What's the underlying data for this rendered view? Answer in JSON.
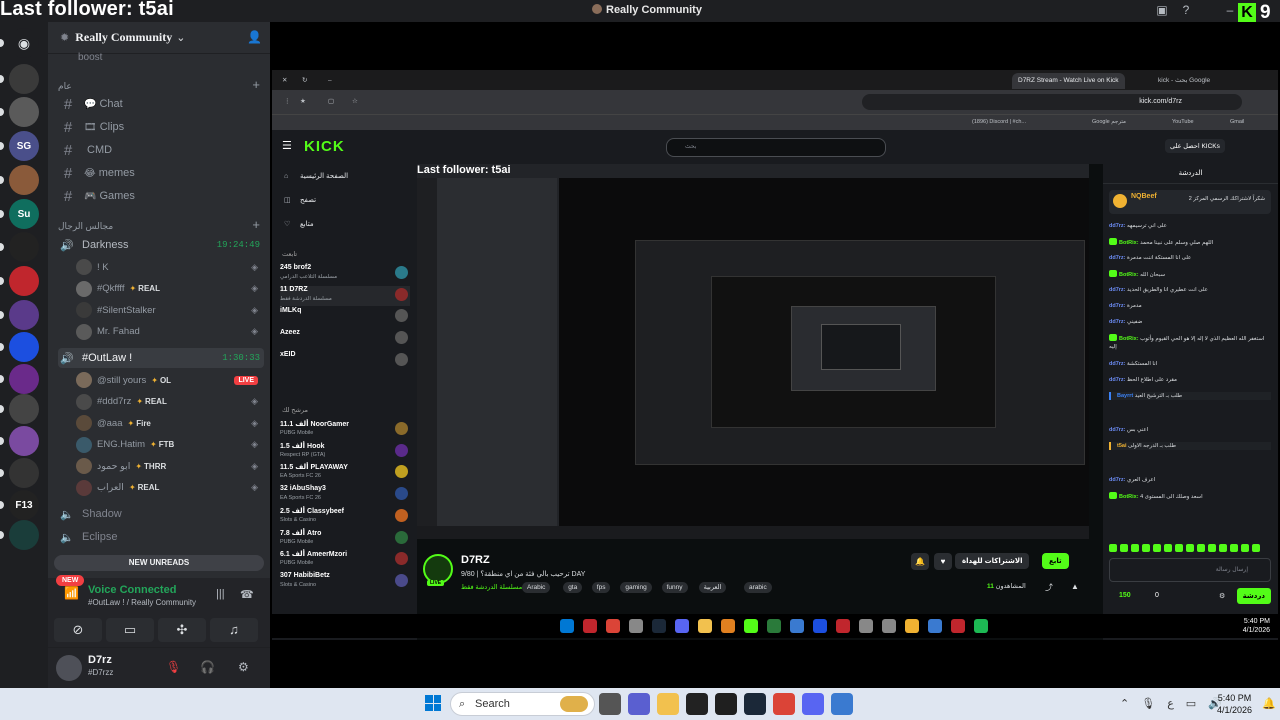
{
  "overlay": {
    "last_follower": "Last follower: t5ai"
  },
  "titlebar": {
    "server_name": "Really Community"
  },
  "kick_overlay": {
    "count": "9"
  },
  "server_rail": {
    "items": [
      {
        "icon": "discord-logo-icon",
        "color": "#1e1f22",
        "label": ""
      },
      {
        "icon": "server-icon",
        "color": "#3a3a3a",
        "label": ""
      },
      {
        "icon": "server-icon",
        "color": "#5a5a5a",
        "label": "",
        "badge": "1"
      },
      {
        "icon": "server-icon",
        "color": "#4a4f8a",
        "label": "SG",
        "badge": "2"
      },
      {
        "icon": "server-icon",
        "color": "#8a5a3a",
        "label": "",
        "badge": "1"
      },
      {
        "icon": "server-icon",
        "color": "#0f6e5e",
        "label": "Su"
      },
      {
        "icon": "server-icon",
        "color": "#222",
        "label": ""
      },
      {
        "icon": "server-icon",
        "color": "#c0262d",
        "label": ""
      },
      {
        "icon": "server-icon",
        "color": "#5a3a8a",
        "label": "",
        "badge": "1"
      },
      {
        "icon": "server-icon",
        "color": "#1c4fe0",
        "label": ""
      },
      {
        "icon": "server-icon",
        "color": "#6a2a8a",
        "label": "",
        "badge": "1"
      },
      {
        "icon": "server-icon",
        "color": "#444",
        "label": ""
      },
      {
        "icon": "server-icon",
        "color": "#7a4aa0",
        "label": ""
      },
      {
        "icon": "server-icon",
        "color": "#333",
        "label": ""
      },
      {
        "icon": "server-icon",
        "color": "#222",
        "label": "F13"
      },
      {
        "icon": "server-icon",
        "color": "#1a3d3a",
        "label": ""
      }
    ]
  },
  "sidebar": {
    "server_name": "Really Community",
    "boost": "boost",
    "category_text": "عام",
    "category_voice": "مجالس الرجال",
    "text_channels": [
      {
        "emoji": "💬",
        "name": "Chat"
      },
      {
        "emoji": "🎞",
        "name": "Clips"
      },
      {
        "emoji": "",
        "name": "CMD"
      },
      {
        "emoji": "😂",
        "name": "memes"
      },
      {
        "emoji": "🎮",
        "name": "Games"
      }
    ],
    "voice_darkness": {
      "name": "Darkness",
      "timer": "19:24:49"
    },
    "darkness_users": [
      {
        "name": "! K",
        "tag": "",
        "avatar": "#4a4a4a"
      },
      {
        "name": "#Qkffff",
        "tag": "REAL",
        "avatar": "#6a6a6a"
      },
      {
        "name": "#SilentStalker",
        "tag": "",
        "avatar": "#3a3a3a"
      },
      {
        "name": "Mr. Fahad",
        "tag": "",
        "avatar": "#5a5a5a"
      }
    ],
    "voice_outlaw": {
      "name": "#OutLaw !",
      "timer": "1:30:33"
    },
    "outlaw_users": [
      {
        "name": "@still yours",
        "tag": "OL",
        "avatar": "#7a6a5a",
        "live": "LIVE"
      },
      {
        "name": "#ddd7rz",
        "tag": "REAL",
        "avatar": "#4a4a4a"
      },
      {
        "name": "@aaa",
        "tag": "Fire",
        "avatar": "#5a4a3a"
      },
      {
        "name": "ENG.Hatim",
        "tag": "FTB",
        "avatar": "#3a5a6a"
      },
      {
        "name": "ابو حمود",
        "tag": "THRR",
        "avatar": "#6a5a4a"
      },
      {
        "name": "العراب",
        "tag": "REAL",
        "avatar": "#5a3a3a"
      }
    ],
    "other_voice": [
      "Shadow",
      "Eclipse"
    ],
    "new_unreads": "NEW UNREADS",
    "new_tag": "NEW",
    "voice_connected": "Voice Connected",
    "voice_location": "#OutLaw ! / Really Community",
    "user_name": "D7rz",
    "user_status": "#D7rzz"
  },
  "browser": {
    "tabs": [
      {
        "label": "D7RZ Stream - Watch Live on Kick",
        "active": true
      },
      {
        "label": "kick - بحث Google",
        "active": false
      }
    ],
    "url": "kick.com/d7rz",
    "bookmarks": [
      "(1896) Discord | #ch...",
      "Google مترجم",
      "YouTube",
      "Gmail"
    ]
  },
  "kick": {
    "logo": "KICK",
    "search_placeholder": "بحث",
    "get_kicks": "احصل على KICKs",
    "nav": [
      "الصفحة الرئيسية",
      "تصفح",
      "متابع"
    ],
    "following_head": "تابعت",
    "recommended_head": "مرشح لك",
    "following": [
      {
        "name": "brof2",
        "sub": "مسلسلة التلاعب الدرامي",
        "viewers": "245",
        "color": "#2a7a8a"
      },
      {
        "name": "D7RZ",
        "sub": "مسلسلة الدردشة فقط",
        "viewers": "11",
        "color": "#8a2a2a"
      },
      {
        "name": "iMLKq",
        "sub": "",
        "viewers": "",
        "color": "#555"
      },
      {
        "name": "Azeez",
        "sub": "",
        "viewers": "",
        "color": "#555"
      },
      {
        "name": "xEID",
        "sub": "",
        "viewers": "",
        "color": "#555"
      }
    ],
    "recommended": [
      {
        "name": "NoorGamer",
        "sub": "PUBG Mobile",
        "viewers": "11.1 ألف",
        "color": "#8a6a2a"
      },
      {
        "name": "Hook",
        "sub": "Respect RP (GTA)",
        "viewers": "1.5 ألف",
        "color": "#5a2a8a"
      },
      {
        "name": "PLAYAWAY",
        "sub": "EA Sports FC 26",
        "viewers": "11.5 ألف",
        "color": "#c0a020"
      },
      {
        "name": "iAbuShay3",
        "sub": "EA Sports FC 26",
        "viewers": "32",
        "color": "#2a4a8a"
      },
      {
        "name": "Classybeef",
        "sub": "Slots & Casino",
        "viewers": "2.5 ألف",
        "color": "#c06020"
      },
      {
        "name": "Atro",
        "sub": "PUBG Mobile",
        "viewers": "7.8 ألف",
        "color": "#2a6a3a"
      },
      {
        "name": "AmeerMzori",
        "sub": "PUBG Mobile",
        "viewers": "6.1 ألف",
        "color": "#8a2a2a"
      },
      {
        "name": "HabibiBetz",
        "sub": "Slots & Casino",
        "viewers": "307",
        "color": "#4a4a8a"
      }
    ],
    "stream_overlay": "Last follower: t5ai",
    "streamer": "D7RZ",
    "stream_title": "ترحيب بالي فئة من اي منطقة؟ | 9/80 DAY",
    "stream_category": "مسلسلة الدردشة فقط",
    "live": "LIVE",
    "tags": [
      "Arabic",
      "gta",
      "fps",
      "gaming",
      "funny",
      "العربية",
      "arabic"
    ],
    "follow_btn": "تابع",
    "subscribe_btn": "الاشتراكات للهداة",
    "viewers_label": "المشاهدون",
    "viewers_count": "11",
    "chat_title": "الدردشة",
    "pinned_user": "NQBeef",
    "pinned_text": "شكراً لاشتراكك الرسمي المركز 2",
    "chat_messages": [
      {
        "user": "dd7rz:",
        "text": "على اني ترسيمهه",
        "type": ""
      },
      {
        "user": "BotRix:",
        "text": "اللهم صلي وسلم على نبينا محمد",
        "type": "bot"
      },
      {
        "user": "dd7rz:",
        "text": "على انا المستكة اننت مدمرة",
        "type": ""
      },
      {
        "user": "BotRix:",
        "text": "سبحان الله",
        "type": "bot"
      },
      {
        "user": "dd7rz:",
        "text": "على انت عطيري انا والطريق الحديد",
        "type": ""
      },
      {
        "user": "dd7rz:",
        "text": "مدمرة",
        "type": ""
      },
      {
        "user": "dd7rz:",
        "text": "ضفيني",
        "type": ""
      },
      {
        "user": "BotRix:",
        "text": "استغفر الله العظيم الذي لا إله إلا هو الحي القيوم وأتوب إليه",
        "type": "bot"
      },
      {
        "user": "dd7rz:",
        "text": "انا المستكشة",
        "type": ""
      },
      {
        "user": "dd7rz:",
        "text": "مقرد على اطلاع الحظ",
        "type": ""
      },
      {
        "user": "Bayrrt",
        "text": "طلب بـ الترشيح العيد",
        "type": "sub2"
      },
      {
        "user": "dd7rz:",
        "text": "اعني بس",
        "type": ""
      },
      {
        "user": "t5ai",
        "text": "طلب بـ الدرجه الاولى",
        "type": "sub"
      },
      {
        "user": "dd7rz:",
        "text": "اعرف العري",
        "type": ""
      },
      {
        "user": "BotRix:",
        "text": "اسعد وصلك الى المستوى 4",
        "type": "bot"
      }
    ],
    "chat_input": "إرسال رسالة",
    "points": "150",
    "points2": "0",
    "send": "دردشة",
    "inner_time": "5:40 PM",
    "inner_date": "4/1/2026"
  },
  "taskbar": {
    "search": "Search",
    "time": "5:40 PM",
    "date": "4/1/2026",
    "lang": "ع",
    "apps": [
      {
        "icon": "file-explorer-icon",
        "color": "#555"
      },
      {
        "icon": "teams-icon",
        "color": "#5a5fd0"
      },
      {
        "icon": "folder-icon",
        "color": "#f2c14e"
      },
      {
        "icon": "obs-icon",
        "color": "#222"
      },
      {
        "icon": "terminal-icon",
        "color": "#1f1f1f"
      },
      {
        "icon": "steam-icon",
        "color": "#1b2838"
      },
      {
        "icon": "chrome-icon",
        "color": "#db4437"
      },
      {
        "icon": "discord-icon",
        "color": "#5865f2"
      },
      {
        "icon": "app-icon",
        "color": "#3a7ad0"
      }
    ]
  }
}
